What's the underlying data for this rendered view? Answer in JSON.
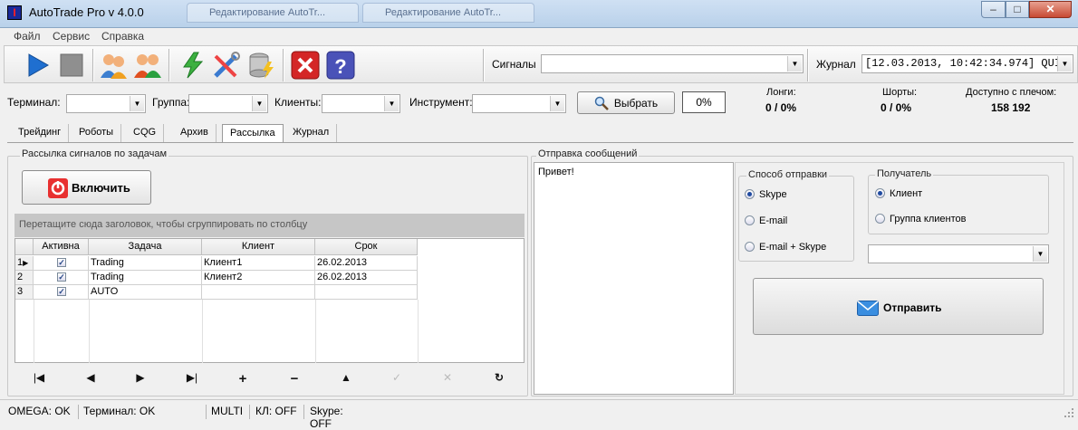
{
  "window": {
    "title": "AutoTrade Pro v 4.0.0",
    "app_icon": "I",
    "bg_tabs": [
      "Редактирование AutoTr...",
      "Редактирование AutoTr..."
    ],
    "minimize": "–",
    "maximize": "□",
    "close": "✕"
  },
  "menu": [
    "Файл",
    "Сервис",
    "Справка"
  ],
  "toolbar": {
    "signals_label": "Сигналы",
    "signals_value": "",
    "journal_label": "Журнал",
    "journal_value": "[12.03.2013, 10:42:34.974] QUI"
  },
  "filters": {
    "terminal_label": "Терминал:",
    "group_label": "Группа:",
    "clients_label": "Клиенты:",
    "instrument_label": "Инструмент:",
    "select_button": "Выбрать",
    "percent": "0%"
  },
  "stats": {
    "longs_label": "Лонги:",
    "longs_value": "0 / 0%",
    "shorts_label": "Шорты:",
    "shorts_value": "0 / 0%",
    "avail_label": "Доступно с плечом:",
    "avail_value": "158 192"
  },
  "tabs": [
    "Трейдинг",
    "Роботы",
    "CQG",
    "Архив",
    "Рассылка",
    "Журнал"
  ],
  "left": {
    "group_title": "Рассылка сигналов по задачам",
    "enable_button": "Включить",
    "group_bar": "Перетащите сюда заголовок, чтобы сгруппировать по столбцу",
    "columns": [
      "Активна",
      "Задача",
      "Клиент",
      "Срок"
    ],
    "rows": [
      {
        "num": "1",
        "task": "Trading",
        "client": "Клиент1",
        "date": "26.02.2013"
      },
      {
        "num": "2",
        "task": "Trading",
        "client": "Клиент2",
        "date": "26.02.2013"
      },
      {
        "num": "3",
        "task": "AUTO",
        "client": "",
        "date": ""
      }
    ],
    "nav": [
      "|◀",
      "◀",
      "▶",
      "▶|",
      "+",
      "−",
      "▲",
      "✓",
      "✕",
      "↻"
    ]
  },
  "right": {
    "group_title": "Отправка сообщений",
    "message": "Привет!",
    "method_title": "Способ отправки",
    "methods": [
      "Skype",
      "E-mail",
      "E-mail + Skype"
    ],
    "recipient_title": "Получатель",
    "recipients": [
      "Клиент",
      "Группа клиентов"
    ],
    "recipient_value": "",
    "send_button": "Отправить"
  },
  "status": [
    "OMEGA: OK",
    "Терминал: OK",
    "MULTI",
    "КЛ: OFF",
    "Skype: OFF"
  ],
  "colors": {
    "accent_blue": "#1f6fd0",
    "stop_red": "#d42626"
  }
}
